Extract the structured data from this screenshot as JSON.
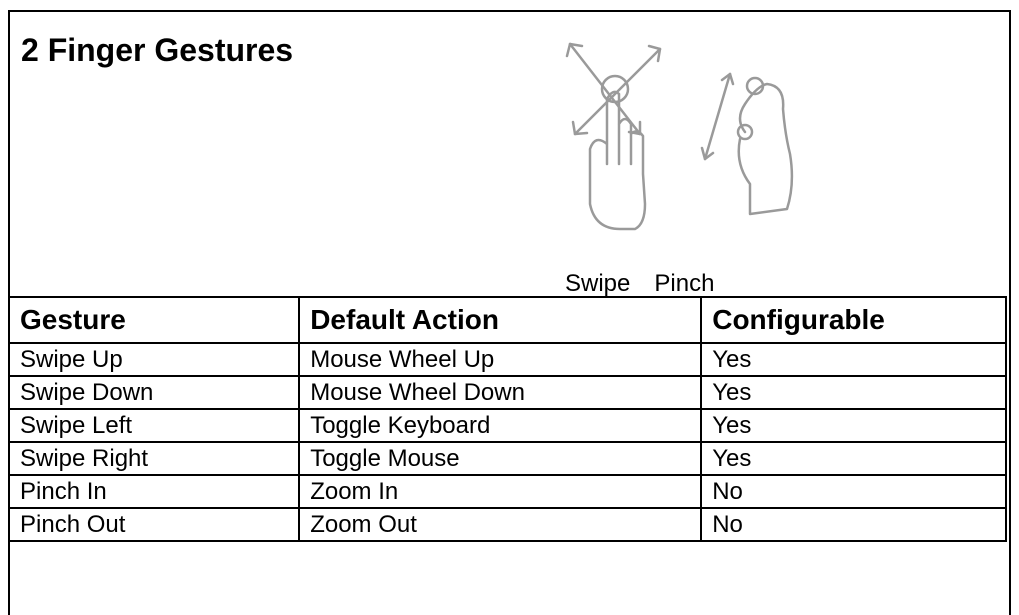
{
  "title": "2 Finger Gestures",
  "captions": {
    "swipe": "Swipe",
    "pinch": "Pinch"
  },
  "illustrations": {
    "swipe": "swipe-gesture-icon",
    "pinch": "pinch-gesture-icon"
  },
  "table": {
    "headers": [
      "Gesture",
      "Default Action",
      "Configurable"
    ],
    "rows": [
      [
        "Swipe Up",
        "Mouse Wheel Up",
        "Yes"
      ],
      [
        "Swipe Down",
        "Mouse Wheel Down",
        "Yes"
      ],
      [
        "Swipe Left",
        "Toggle Keyboard",
        "Yes"
      ],
      [
        "Swipe Right",
        "Toggle Mouse",
        "Yes"
      ],
      [
        "Pinch In",
        "Zoom In",
        "No"
      ],
      [
        "Pinch Out",
        "Zoom Out",
        "No"
      ]
    ]
  }
}
